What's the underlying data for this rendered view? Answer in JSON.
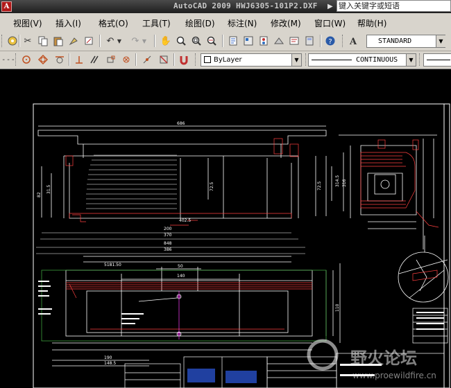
{
  "titlebar": {
    "app_title": "AutoCAD 2009",
    "file_name": "HWJ6305-101P2.DXF",
    "help_placeholder": "键入关键字或短语",
    "logo_glyph": "A"
  },
  "menu": {
    "items": [
      "视图(V)",
      "插入(I)",
      "格式(O)",
      "工具(T)",
      "绘图(D)",
      "标注(N)",
      "修改(M)",
      "窗口(W)",
      "帮助(H)"
    ]
  },
  "toolbar": {
    "text_style": "STANDARD",
    "layer": "ByLayer",
    "linetype": "CONTINUOUS"
  },
  "drawing": {
    "dims_top": [
      "686",
      "370",
      "386",
      "200"
    ],
    "dims_mid": [
      "848",
      "370",
      "402.5"
    ],
    "dims_front": [
      "72.5",
      "31.5",
      "72.5",
      "82"
    ],
    "dims_plan": [
      "5181.50",
      "50",
      "140",
      "110"
    ],
    "dims_bottom": [
      "190",
      "148.5"
    ],
    "side_dims": [
      "316",
      "314.5"
    ],
    "watermark_cn": "野火论坛",
    "watermark_url": "www.proewildfire.cn"
  },
  "colors": {
    "model_bg": "#000000",
    "line_white": "#ffffff",
    "line_red": "#ff4040",
    "line_green": "#3ca03c",
    "line_magenta": "#ff40ff",
    "line_yellow": "#ffff40",
    "toolbar_bg": "#d8d4cc"
  }
}
